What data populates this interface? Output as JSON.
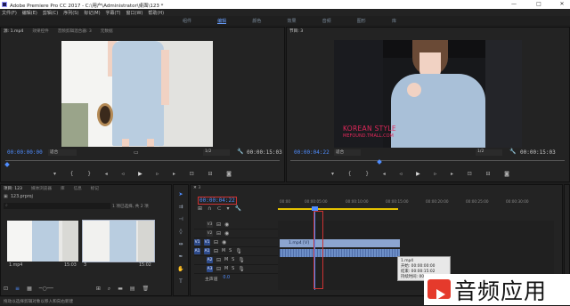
{
  "window": {
    "title": "Adobe Premiere Pro CC 2017 - C:\\用户\\Administrator\\桌面\\123 *",
    "controls": [
      "—",
      "□",
      "✕"
    ]
  },
  "menu": [
    "文件(F)",
    "编辑(E)",
    "剪辑(C)",
    "序列(S)",
    "标记(M)",
    "字幕(T)",
    "窗口(W)",
    "帮助(H)"
  ],
  "workspaces": [
    "组件",
    "编辑",
    "颜色",
    "效果",
    "音频",
    "图形",
    "库"
  ],
  "workspace_active": 1,
  "source_panel": {
    "tabs": [
      "源: 1.mp4",
      "效果控件",
      "音频剪辑混合器: 3",
      "元数据"
    ],
    "timecode_in": "00:00:00:00",
    "fit": "适合",
    "scale": "1/2",
    "duration": "00:00:15:03"
  },
  "program_panel": {
    "tab": "节目: 3",
    "timecode": "00:00:04:22",
    "fit": "适合",
    "scale": "1/2",
    "duration": "00:00:15:03",
    "overlay_line1": "KOREAN STYLE",
    "overlay_line2": "MEFOUND.TMALL.COM"
  },
  "project_panel": {
    "tabs": [
      "项目: 123",
      "媒体浏览器",
      "库",
      "信息",
      "标记"
    ],
    "file": "123.prproj",
    "status": "1 项已选择, 共 2 项",
    "items": [
      {
        "name": "1.mp4",
        "duration": "15:03"
      },
      {
        "name": "3",
        "duration": "15:02"
      }
    ]
  },
  "timeline": {
    "tab": "3",
    "timecode": "00:00:04:22",
    "ruler": [
      "00:00",
      "00:00:05:00",
      "00:00:10:00",
      "00:00:15:00",
      "00:00:20:00",
      "00:00:25:00",
      "00:00:30:00"
    ],
    "tracks_video": [
      "V3",
      "V2",
      "V1"
    ],
    "tracks_audio": [
      "A1",
      "A2",
      "A3"
    ],
    "master": "主声道",
    "master_value": "0.0",
    "clip_video_label": "1.mp4 [V]",
    "tooltip": {
      "name": "1.mp4",
      "start": "开始: 00:00:00:00",
      "end": "结束: 00:00:15:02",
      "dur": "持续时间: 00:00:15:03"
    }
  },
  "statusbar": "拖动以选择剪辑对象以移入和向右新建",
  "watermark": "音频应用",
  "colors": {
    "accent": "#4f8dff",
    "clip_video": "#8ca5d0",
    "clip_audio": "#6d8fc7",
    "tooltip_bg": "#e8e8e8"
  }
}
